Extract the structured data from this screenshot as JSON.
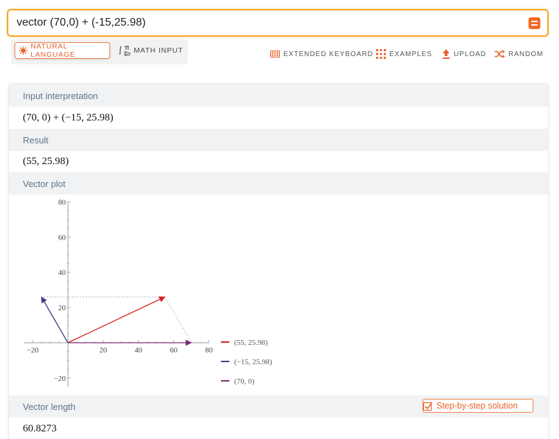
{
  "search": {
    "query": "vector (70,0) + (-15,25.98)"
  },
  "modes": {
    "natural_language": "NATURAL LANGUAGE",
    "math_input": "MATH INPUT"
  },
  "tools": {
    "keyboard": "EXTENDED KEYBOARD",
    "examples": "EXAMPLES",
    "upload": "UPLOAD",
    "random": "RANDOM"
  },
  "pods": {
    "input": {
      "title": "Input interpretation",
      "value": "(70, 0) + (−15, 25.98)"
    },
    "result": {
      "title": "Result",
      "value": "(55, 25.98)"
    },
    "plot": {
      "title": "Vector plot"
    },
    "length": {
      "title": "Vector length",
      "value": "60.8273",
      "step_button": "Step-by-step solution"
    }
  },
  "colors": {
    "accent": "#f26b21",
    "search_border": "#f3a623"
  },
  "chart_data": {
    "type": "line",
    "xlim": [
      -25,
      80
    ],
    "ylim": [
      -25,
      80
    ],
    "xticks": [
      -20,
      20,
      40,
      60,
      80
    ],
    "xtick_labels": [
      "−20",
      "20",
      "40",
      "60",
      "80"
    ],
    "yticks": [
      -20,
      20,
      40,
      60,
      80
    ],
    "ytick_labels": [
      "−20",
      "20",
      "40",
      "60",
      "80"
    ],
    "series": [
      {
        "name": "(55, 25.98)",
        "x": [
          0,
          55
        ],
        "y": [
          0,
          25.98
        ],
        "color": "#d71e1e"
      },
      {
        "name": "(−15, 25.98)",
        "x": [
          0,
          -15
        ],
        "y": [
          0,
          25.98
        ],
        "color": "#3c3c86"
      },
      {
        "name": "(70, 0)",
        "x": [
          0,
          70
        ],
        "y": [
          0,
          0
        ],
        "color": "#7a2b6e"
      }
    ],
    "guides": [
      {
        "x": [
          -15,
          55
        ],
        "y": [
          25.98,
          25.98
        ]
      },
      {
        "x": [
          55,
          70
        ],
        "y": [
          25.98,
          0
        ]
      }
    ],
    "legend_position": "right"
  }
}
